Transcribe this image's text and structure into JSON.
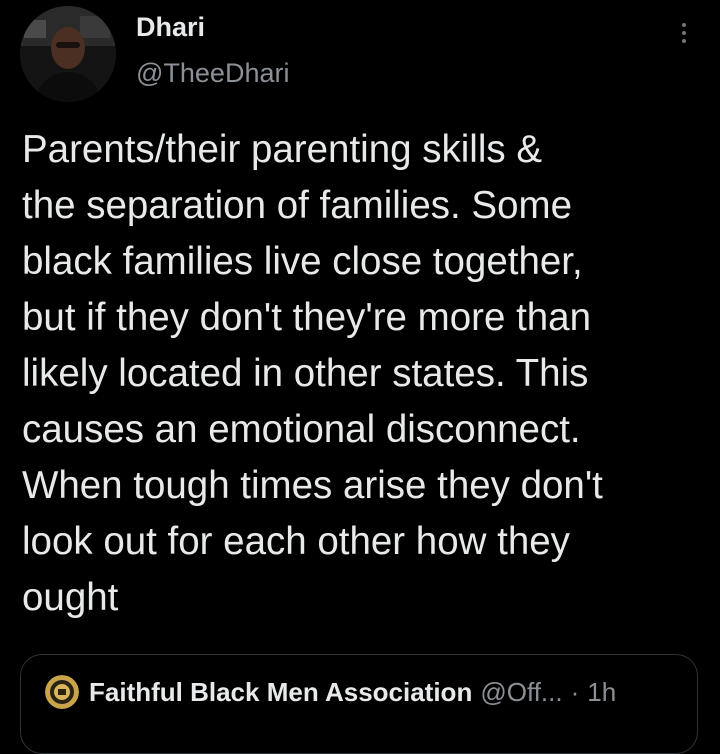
{
  "tweet": {
    "author": {
      "display_name": "Dhari",
      "handle": "@TheeDhari",
      "avatar": "avatar-photo"
    },
    "more_icon": "more-vertical-icon",
    "text_lines": [
      "Parents/their parenting skills &",
      "the separation of families. Some",
      "black families live close together,",
      "but if they don't they're more than",
      "likely located in other states. This",
      "causes an emotional disconnect.",
      "When tough times arise they don't",
      "look out for each other how they",
      "ought"
    ]
  },
  "quoted_tweet": {
    "display_name": "Faithful Black Men Association",
    "handle": "@Off...",
    "separator": "·",
    "time": "1h",
    "avatar": "association-logo"
  },
  "colors": {
    "background": "#000000",
    "primary_text": "#e7e9ea",
    "secondary_text": "#8b9096",
    "border": "#2f3336"
  }
}
